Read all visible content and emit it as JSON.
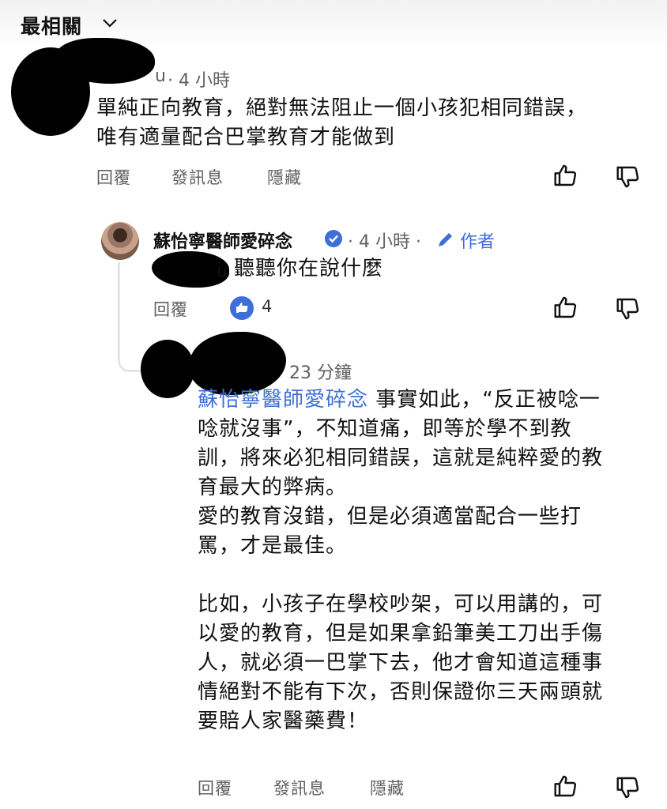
{
  "sort": {
    "label": "最相關"
  },
  "comment1": {
    "username_tail": "u",
    "time": "· 4 小時",
    "text_line1": "單純正向教育，絕對無法阻止一個小孩犯相同錯誤，",
    "text_line2": "唯有適量配合巴掌教育才能做到",
    "actions": {
      "reply": "回覆",
      "message": "發訊息",
      "hide": "隱藏"
    }
  },
  "reply1": {
    "author": "蘇怡寧醫師愛碎念",
    "time": "· 4 小時 ·",
    "author_tag": "作者",
    "mention_tail": "u",
    "text": "聽聽你在說什麼",
    "actions": {
      "reply": "回覆"
    },
    "like_count": "4"
  },
  "reply2": {
    "time": "23 分鐘",
    "mention": "蘇怡寧醫師愛碎念",
    "line1": " 事實如此，“反正被唸一",
    "line2": "唸就沒事”，不知道痛，即等於學不到教",
    "line3": "訓，將來必犯相同錯誤，這就是純粹愛的教",
    "line4": "育最大的弊病。",
    "line5": "愛的教育沒錯，但是必須適當配合一些打",
    "line6": "罵，才是最佳。",
    "line7": "比如，小孩子在學校吵架，可以用講的，可",
    "line8": "以愛的教育，但是如果拿鉛筆美工刀出手傷",
    "line9": "人，就必須一巴掌下去，他才會知道這種事",
    "line10": "情絕對不能有下次，否則保證你三天兩頭就",
    "line11": "要賠人家醫藥費！",
    "actions": {
      "reply": "回覆",
      "message": "發訊息",
      "hide": "隱藏"
    }
  },
  "colors": {
    "link_blue": "#3e6fd8",
    "muted": "#606060"
  }
}
